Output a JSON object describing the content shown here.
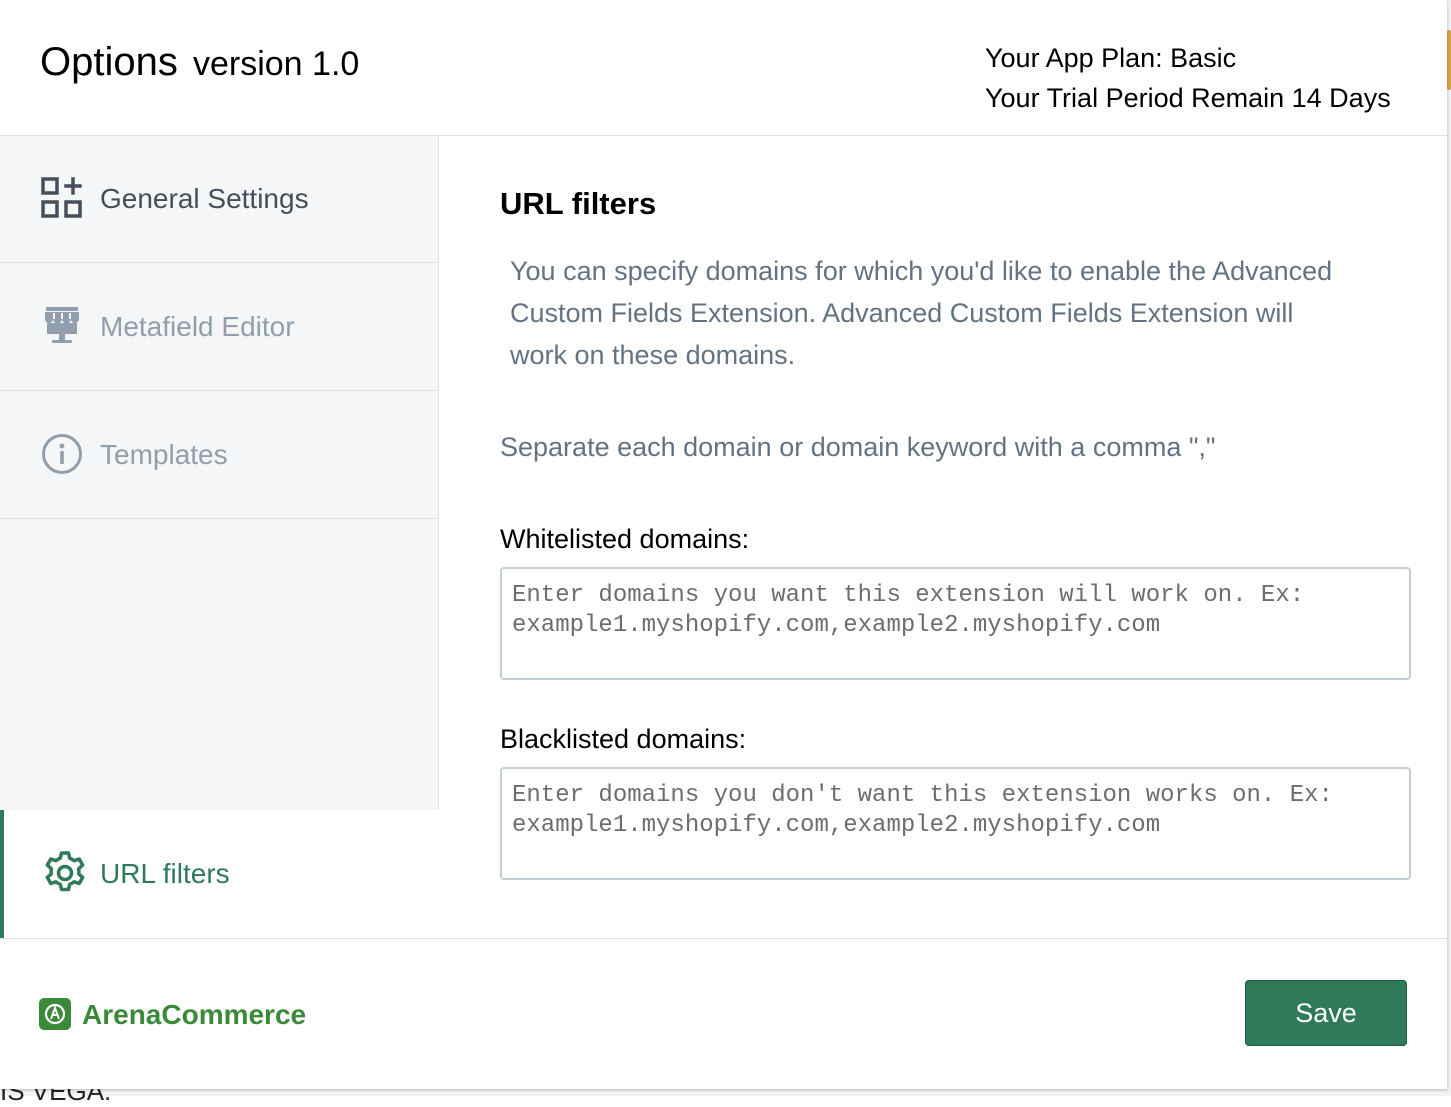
{
  "header": {
    "title": "Options",
    "version": "version 1.0",
    "plan_line": "Your App Plan: Basic",
    "trial_line": "Your Trial Period Remain 14 Days"
  },
  "sidebar": {
    "items": [
      {
        "label": "General Settings",
        "icon": "apps-add-icon",
        "state": "enabled"
      },
      {
        "label": "Metafield Editor",
        "icon": "storefront-icon",
        "state": "muted"
      },
      {
        "label": "Templates",
        "icon": "info-icon",
        "state": "muted"
      },
      {
        "label": "URL filters",
        "icon": "gear-icon",
        "state": "active"
      }
    ]
  },
  "main": {
    "heading": "URL filters",
    "description": "You can specify domains for which you'd like to enable the Advanced Custom Fields Extension. Advanced Custom Fields Extension will work on these domains.",
    "separator_note": "Separate each domain or domain keyword with a comma \",\"",
    "whitelist": {
      "label": "Whitelisted domains:",
      "value": "",
      "placeholder": "Enter domains you want this extension will work on. Ex: example1.myshopify.com,example2.myshopify.com"
    },
    "blacklist": {
      "label": "Blacklisted domains:",
      "value": "",
      "placeholder": "Enter domains you don't want this extension works on. Ex: example1.myshopify.com,example2.myshopify.com"
    }
  },
  "footer": {
    "brand": "ArenaCommerce",
    "brand_icon": "arenacommerce-logo-icon",
    "save_label": "Save"
  },
  "background": {
    "partial_text": "IS VEGA."
  },
  "colors": {
    "accent": "#2f7a59",
    "brand_green": "#3a8a3a",
    "muted_text": "#919eab",
    "body_muted": "#637381",
    "sidebar_bg": "#f4f6f8"
  }
}
